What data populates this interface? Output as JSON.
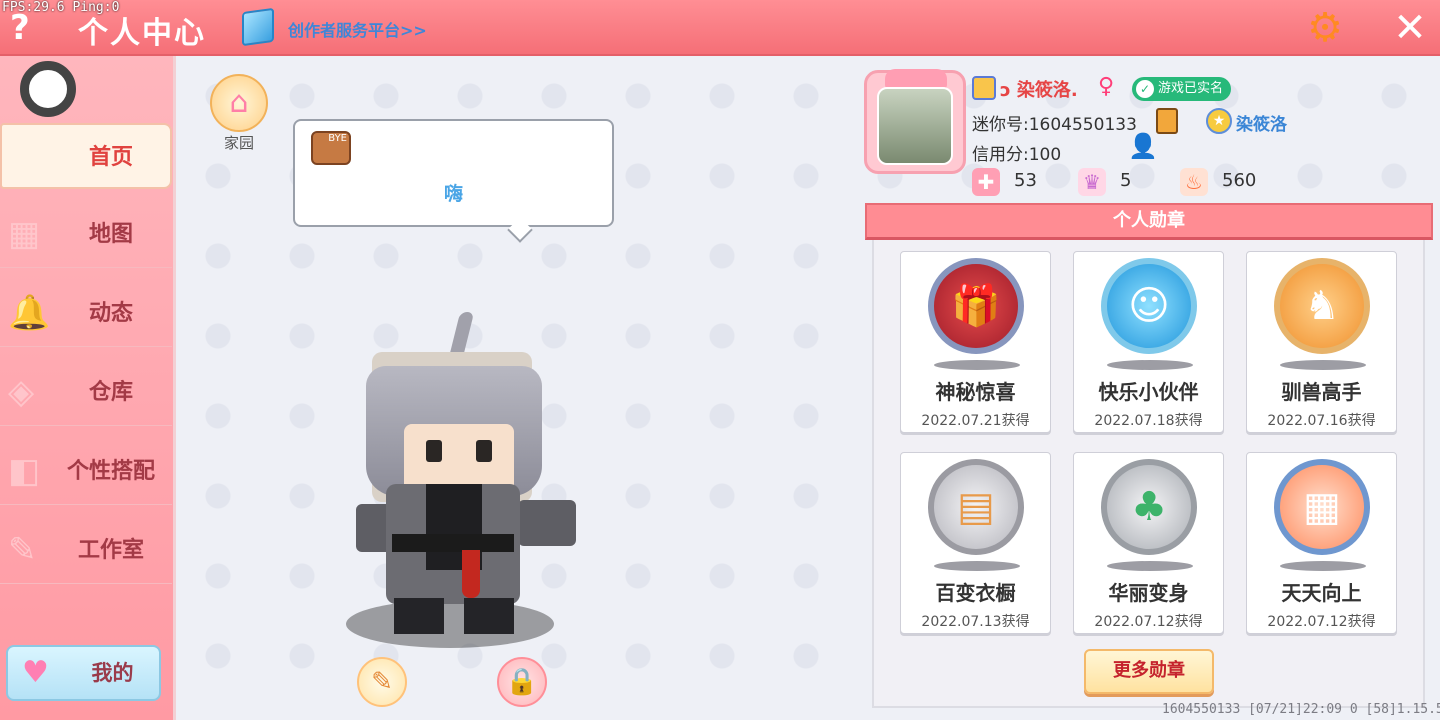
{
  "overlay": {
    "fps_text": "FPS:29.6  Ping:0"
  },
  "header": {
    "help_icon": "question-mark",
    "title": "个人中心",
    "creator_link": "创作者服务平台>>",
    "settings_icon": "gear",
    "close_icon": "close-x",
    "accent_color": "#f56f77"
  },
  "sidebar": {
    "items": [
      {
        "label": "首页",
        "icon": "home",
        "active": true
      },
      {
        "label": "地图",
        "icon": "map"
      },
      {
        "label": "动态",
        "icon": "bell"
      },
      {
        "label": "仓库",
        "icon": "box"
      },
      {
        "label": "个性搭配",
        "icon": "outfit"
      },
      {
        "label": "工作室",
        "icon": "studio"
      }
    ],
    "mine_label": "我的"
  },
  "home": {
    "label": "家园"
  },
  "speech": {
    "text": "嗨",
    "emoji_text": "BYE"
  },
  "profile": {
    "username": "ɔ 染筱洛.",
    "gender_symbol": "♀",
    "verified_label": "游戏已实名",
    "uid": "迷你号:1604550133",
    "friend_name": "染筱洛",
    "credit": "信用分:100",
    "stats": [
      {
        "icon": "health-plus",
        "value": "53",
        "color": "#ff6c8b"
      },
      {
        "icon": "fans",
        "value": "5",
        "color": "#f4a7c6"
      },
      {
        "icon": "flame",
        "value": "560",
        "color": "#ff6f3c"
      }
    ]
  },
  "badges": {
    "title": "个人勋章",
    "items": [
      {
        "name": "神秘惊喜",
        "date": "2022.07.21获得",
        "color": "#c2263a",
        "icon": "gift"
      },
      {
        "name": "快乐小伙伴",
        "date": "2022.07.18获得",
        "color": "#29a7e8",
        "icon": "friends"
      },
      {
        "name": "驯兽高手",
        "date": "2022.07.16获得",
        "color": "#f2a249",
        "icon": "horse"
      },
      {
        "name": "百变衣橱",
        "date": "2022.07.13获得",
        "color": "#b7b7bd",
        "icon": "wardrobe"
      },
      {
        "name": "华丽变身",
        "date": "2022.07.12获得",
        "color": "#a8acb2",
        "icon": "dino"
      },
      {
        "name": "天天向上",
        "date": "2022.07.12获得",
        "color": "#4d8bd0",
        "icon": "calendar"
      }
    ],
    "more_label": "更多勋章"
  },
  "footer": {
    "text": "1604550133   [07/21]22:09 0   [58]1.15.5"
  }
}
